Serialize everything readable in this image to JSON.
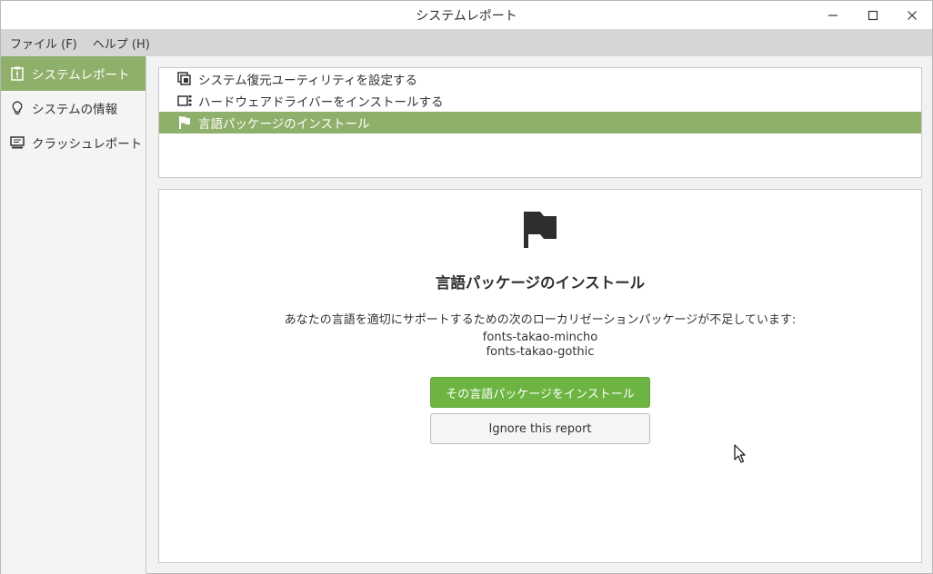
{
  "window": {
    "title": "システムレポート"
  },
  "menubar": {
    "items": [
      "ファイル (F)",
      "ヘルプ (H)"
    ]
  },
  "sidebar": {
    "items": [
      {
        "label": "システムレポート",
        "icon": "report-icon",
        "active": true
      },
      {
        "label": "システムの情報",
        "icon": "lightbulb-icon",
        "active": false
      },
      {
        "label": "クラッシュレポート",
        "icon": "monitor-icon",
        "active": false
      }
    ]
  },
  "reports": {
    "items": [
      {
        "label": "システム復元ユーティリティを設定する",
        "icon": "restore-icon",
        "selected": false
      },
      {
        "label": "ハードウェアドライバーをインストールする",
        "icon": "driver-icon",
        "selected": false
      },
      {
        "label": "言語パッケージのインストール",
        "icon": "flag-icon",
        "selected": true
      }
    ]
  },
  "detail": {
    "icon": "flag-icon",
    "title": "言語パッケージのインストール",
    "description": "あなたの言語を適切にサポートするための次のローカリゼーションパッケージが不足しています:",
    "packages": [
      "fonts-takao-mincho",
      "fonts-takao-gothic"
    ],
    "install_label": "その言語パッケージをインストール",
    "ignore_label": "Ignore this report"
  },
  "colors": {
    "accent": "#8fb06a",
    "button_green": "#6db442"
  }
}
